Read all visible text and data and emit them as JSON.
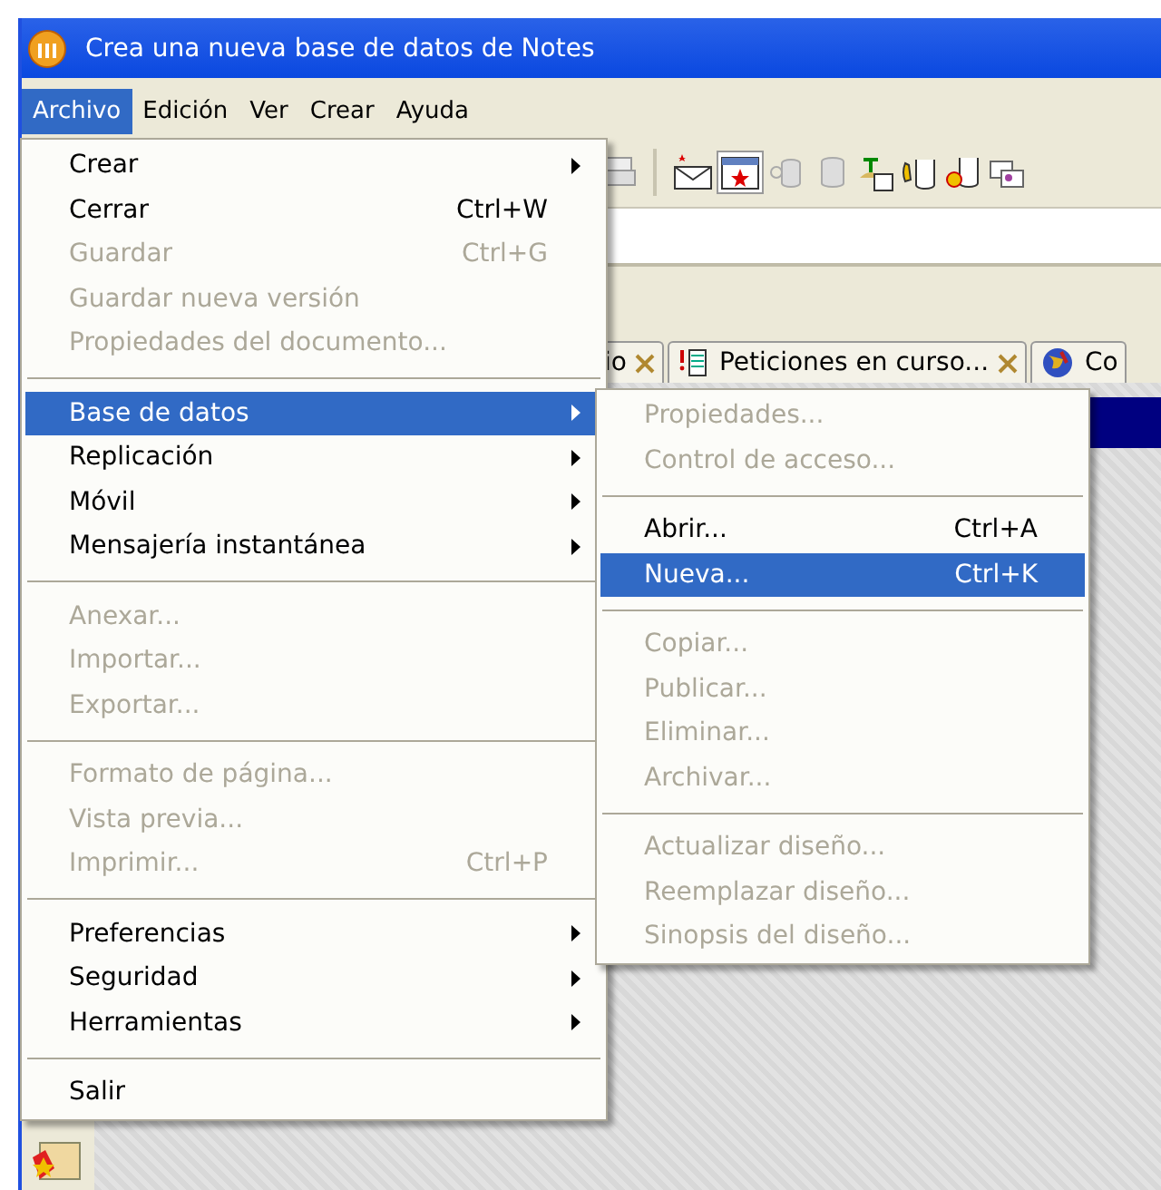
{
  "window": {
    "title": "Crea una nueva base de datos de Notes"
  },
  "menubar": [
    {
      "label": "Archivo",
      "selected": true
    },
    {
      "label": "Edición",
      "selected": false
    },
    {
      "label": "Ver",
      "selected": false
    },
    {
      "label": "Crear",
      "selected": false
    },
    {
      "label": "Ayuda",
      "selected": false
    }
  ],
  "tabs": [
    {
      "label": "io",
      "selected": false
    },
    {
      "label": "Peticiones en curso...",
      "selected": false
    },
    {
      "label": "Co",
      "selected": false
    }
  ],
  "file_menu": {
    "items": [
      {
        "kind": "item",
        "label": "Crear",
        "submenu": true,
        "disabled": false,
        "selected": false
      },
      {
        "kind": "item",
        "label": "Cerrar",
        "shortcut": "Ctrl+W",
        "disabled": false,
        "selected": false
      },
      {
        "kind": "item",
        "label": "Guardar",
        "shortcut": "Ctrl+G",
        "disabled": true,
        "selected": false
      },
      {
        "kind": "item",
        "label": "Guardar nueva versión",
        "disabled": true,
        "selected": false
      },
      {
        "kind": "item",
        "label": "Propiedades del documento...",
        "disabled": true,
        "selected": false
      },
      {
        "kind": "separator"
      },
      {
        "kind": "item",
        "label": "Base de datos",
        "submenu": true,
        "disabled": false,
        "selected": true
      },
      {
        "kind": "item",
        "label": "Replicación",
        "submenu": true,
        "disabled": false,
        "selected": false
      },
      {
        "kind": "item",
        "label": "Móvil",
        "submenu": true,
        "disabled": false,
        "selected": false
      },
      {
        "kind": "item",
        "label": "Mensajería instantánea",
        "submenu": true,
        "disabled": false,
        "selected": false
      },
      {
        "kind": "separator"
      },
      {
        "kind": "item",
        "label": "Anexar...",
        "disabled": true,
        "selected": false
      },
      {
        "kind": "item",
        "label": "Importar...",
        "disabled": true,
        "selected": false
      },
      {
        "kind": "item",
        "label": "Exportar...",
        "disabled": true,
        "selected": false
      },
      {
        "kind": "separator"
      },
      {
        "kind": "item",
        "label": "Formato de página...",
        "disabled": true,
        "selected": false
      },
      {
        "kind": "item",
        "label": "Vista previa...",
        "disabled": true,
        "selected": false
      },
      {
        "kind": "item",
        "label": "Imprimir...",
        "shortcut": "Ctrl+P",
        "disabled": true,
        "selected": false
      },
      {
        "kind": "separator"
      },
      {
        "kind": "item",
        "label": "Preferencias",
        "submenu": true,
        "disabled": false,
        "selected": false
      },
      {
        "kind": "item",
        "label": "Seguridad",
        "submenu": true,
        "disabled": false,
        "selected": false
      },
      {
        "kind": "item",
        "label": "Herramientas",
        "submenu": true,
        "disabled": false,
        "selected": false
      },
      {
        "kind": "separator"
      },
      {
        "kind": "item",
        "label": "Salir",
        "disabled": false,
        "selected": false
      }
    ]
  },
  "database_submenu": {
    "items": [
      {
        "kind": "item",
        "label": "Propiedades...",
        "disabled": true,
        "selected": false
      },
      {
        "kind": "item",
        "label": "Control de acceso...",
        "disabled": true,
        "selected": false
      },
      {
        "kind": "separator"
      },
      {
        "kind": "item",
        "label": "Abrir...",
        "shortcut": "Ctrl+A",
        "disabled": false,
        "selected": false
      },
      {
        "kind": "item",
        "label": "Nueva...",
        "shortcut": "Ctrl+K",
        "disabled": false,
        "selected": true
      },
      {
        "kind": "separator"
      },
      {
        "kind": "item",
        "label": "Copiar...",
        "disabled": true,
        "selected": false
      },
      {
        "kind": "item",
        "label": "Publicar...",
        "disabled": true,
        "selected": false
      },
      {
        "kind": "item",
        "label": "Eliminar...",
        "disabled": true,
        "selected": false
      },
      {
        "kind": "item",
        "label": "Archivar...",
        "disabled": true,
        "selected": false
      },
      {
        "kind": "separator"
      },
      {
        "kind": "item",
        "label": "Actualizar diseño...",
        "disabled": true,
        "selected": false
      },
      {
        "kind": "item",
        "label": "Reemplazar diseño...",
        "disabled": true,
        "selected": false
      },
      {
        "kind": "item",
        "label": "Sinopsis del diseño...",
        "disabled": true,
        "selected": false
      }
    ]
  }
}
